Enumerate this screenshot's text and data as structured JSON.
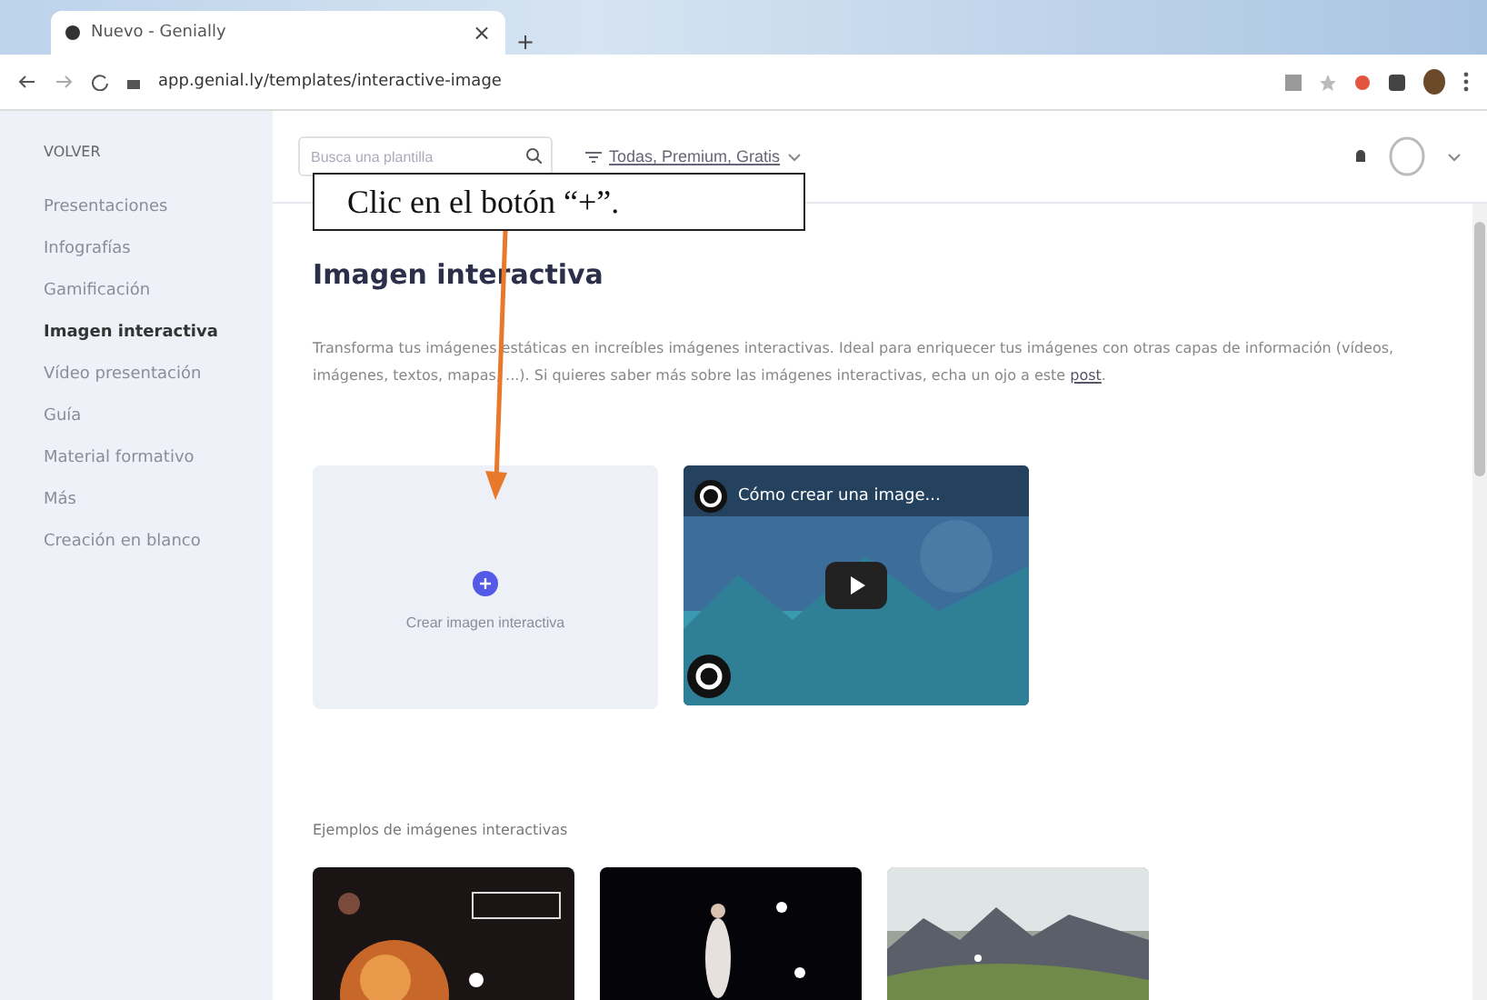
{
  "browser": {
    "tab_title": "Nuevo - Genially",
    "tab_close": "×",
    "new_tab": "+",
    "url": "app.genial.ly/templates/interactive-image"
  },
  "sidebar": {
    "back": "VOLVER",
    "items": [
      {
        "label": "Presentaciones",
        "selected": false
      },
      {
        "label": "Infografías",
        "selected": false
      },
      {
        "label": "Gamificación",
        "selected": false
      },
      {
        "label": "Imagen interactiva",
        "selected": true
      },
      {
        "label": "Vídeo presentación",
        "selected": false
      },
      {
        "label": "Guía",
        "selected": false
      },
      {
        "label": "Material formativo",
        "selected": false
      },
      {
        "label": "Más",
        "selected": false
      },
      {
        "label": "Creación en blanco",
        "selected": false
      }
    ]
  },
  "header": {
    "search": {
      "placeholder": "Busca una plantilla"
    },
    "filter": "Todas, Premium, Gratis"
  },
  "page": {
    "title": "Imagen interactiva",
    "description": "Transforma tus imágenes estáticas en increíbles imágenes interactivas. Ideal para enriquecer tus imágenes con otras capas de información (vídeos, imágenes, textos, mapas, ...). Si quieres saber más sobre las imágenes interactivas, echa un ojo a este",
    "link": "post",
    "link_suffix": ".",
    "create_label": "Crear imagen interactiva",
    "video_title": "Cómo crear una image...",
    "examples_title": "Ejemplos de imágenes interactivas"
  },
  "callout": {
    "text": "Clic en el botón “+”."
  }
}
